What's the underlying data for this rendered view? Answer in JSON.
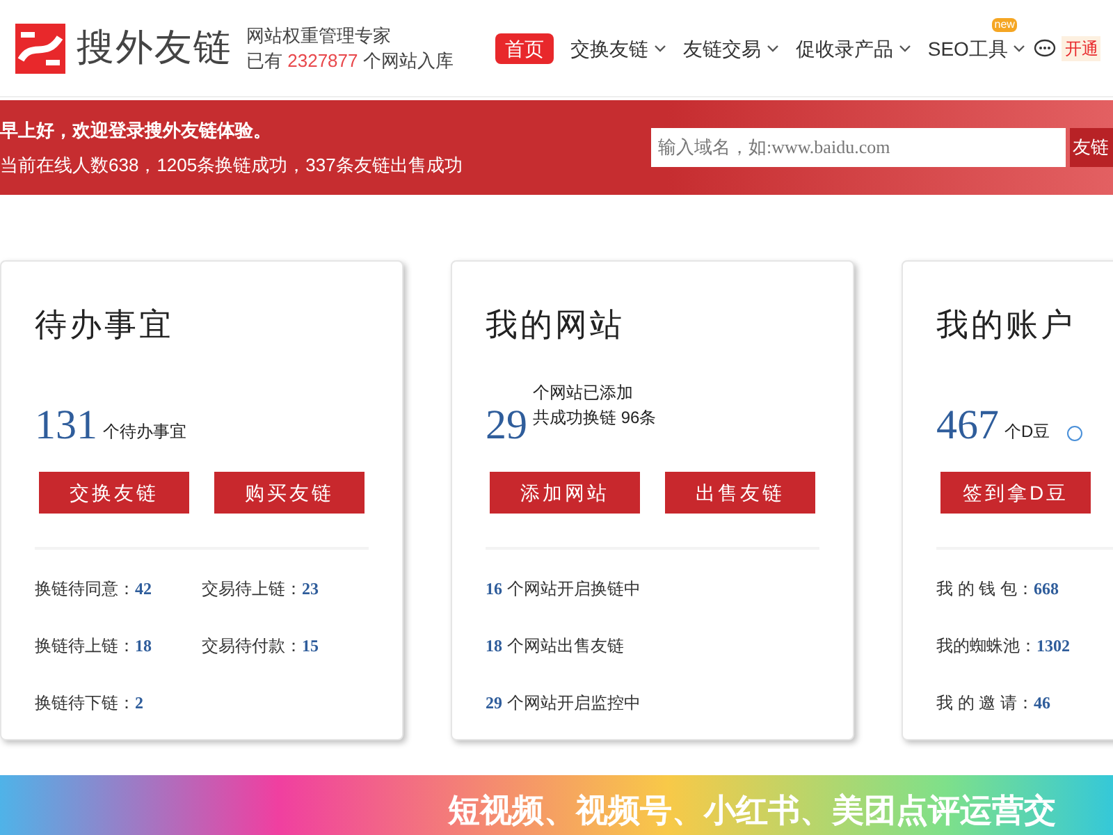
{
  "header": {
    "logo_text": "搜外友链",
    "tagline": "网站权重管理专家",
    "count_prefix": "已有",
    "count": "2327877",
    "count_suffix": "个网站入库",
    "nav": [
      {
        "label": "首页",
        "selected": true,
        "dropdown": false
      },
      {
        "label": "交换友链",
        "selected": false,
        "dropdown": true
      },
      {
        "label": "友链交易",
        "selected": false,
        "dropdown": true
      },
      {
        "label": "促收录产品",
        "selected": false,
        "dropdown": true
      },
      {
        "label": "SEO工具",
        "selected": false,
        "dropdown": true,
        "badge": "new"
      }
    ],
    "vip": "开通"
  },
  "welcome": {
    "greeting": "早上好，欢迎登录搜外友链体验。",
    "stats": "当前在线人数638，1205条换链成功，337条友链出售成功",
    "search": {
      "placeholder": "输入域名，如:www.baidu.com"
    },
    "search_button": "友链"
  },
  "cards": [
    {
      "title": "待办事宜",
      "number": "131",
      "unit_lines": [
        "个待办事宜"
      ],
      "help": false,
      "buttons": [
        "交换友链",
        "购买友链"
      ],
      "kind": "grid",
      "stats": [
        {
          "kind": "label_first",
          "label": "换链待同意：",
          "value": "42"
        },
        {
          "kind": "label_first",
          "label": "交易待上链：",
          "value": "23"
        },
        {
          "kind": "label_first",
          "label": "换链待上链：",
          "value": "18"
        },
        {
          "kind": "label_first",
          "label": "交易待付款：",
          "value": "15"
        },
        {
          "kind": "label_first",
          "label": "换链待下链：",
          "value": "2"
        }
      ]
    },
    {
      "title": "我的网站",
      "number": "29",
      "unit_lines": [
        "个网站已添加",
        "共成功换链 96条"
      ],
      "help": false,
      "buttons": [
        "添加网站",
        "出售友链"
      ],
      "kind": "list",
      "stats": [
        {
          "kind": "value_first",
          "label": "个网站开启换链中",
          "value": "16"
        },
        {
          "kind": "value_first",
          "label": "个网站出售友链",
          "value": "18"
        },
        {
          "kind": "value_first",
          "label": "个网站开启监控中",
          "value": "29"
        }
      ]
    },
    {
      "title": "我的账户",
      "number": "467",
      "unit_lines": [
        "个D豆"
      ],
      "help": true,
      "buttons": [
        "签到拿D豆"
      ],
      "kind": "list",
      "stats": [
        {
          "kind": "label_first",
          "label": "我 的 钱 包：",
          "value": "668"
        },
        {
          "kind": "label_first",
          "label": "我的蜘蛛池：",
          "value": "1302"
        },
        {
          "kind": "label_first",
          "label": "我 的 邀 请：",
          "value": "46"
        }
      ]
    }
  ],
  "promo_banner": {
    "headline": "短视频、视频号、小红书、美团点评运营交"
  }
}
